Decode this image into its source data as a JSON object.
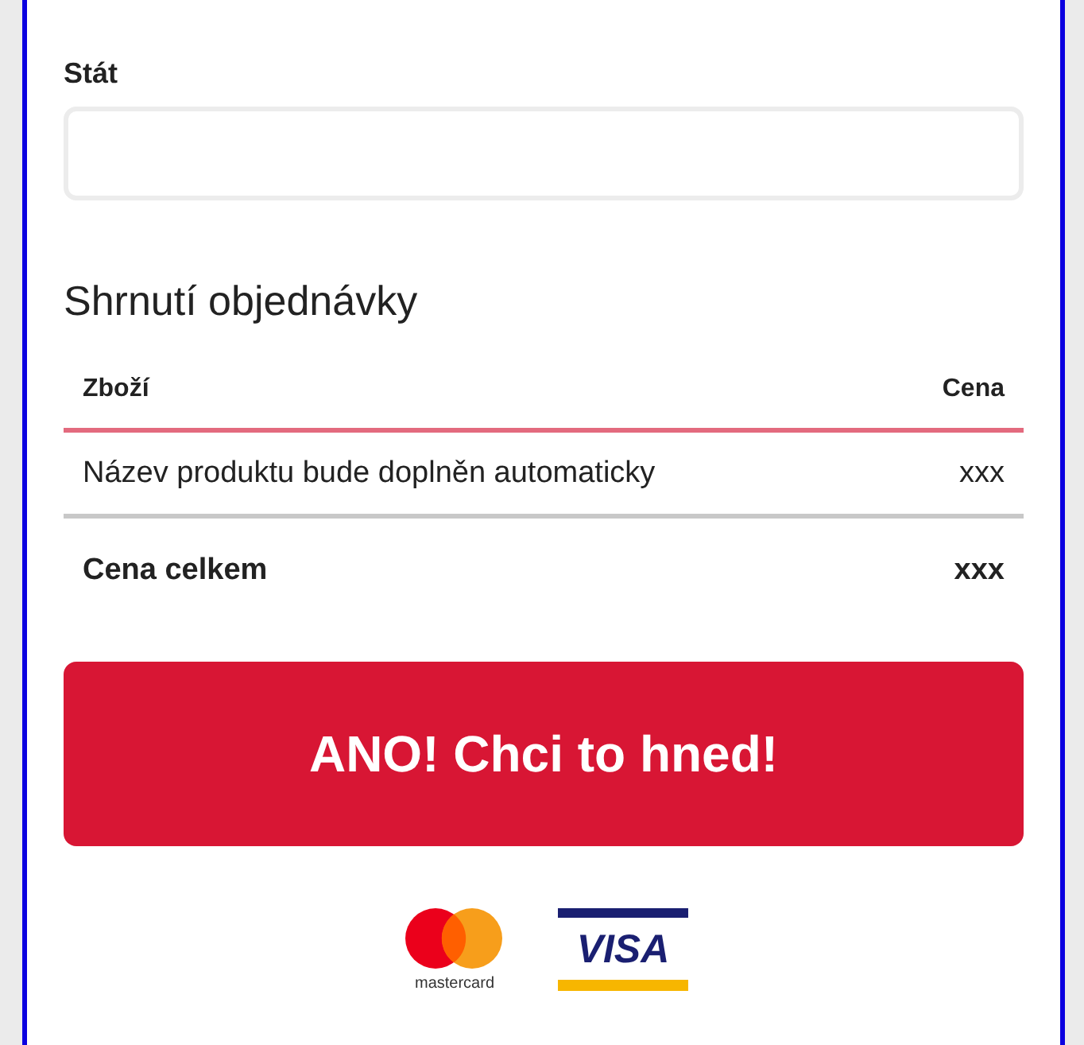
{
  "country_field": {
    "label": "Stát"
  },
  "order_summary": {
    "title": "Shrnutí objednávky",
    "columns": [
      "Zboží",
      "Cena"
    ],
    "rows": [
      {
        "product": "Název produktu bude doplněn automaticky",
        "price": "xxx"
      }
    ],
    "total": {
      "label": "Cena celkem",
      "price": "xxx"
    }
  },
  "submit_button": {
    "label": "ANO! Chci to hned!"
  },
  "payment_logos": [
    {
      "kind": "mastercard",
      "wordmark": "mastercard"
    },
    {
      "kind": "visa",
      "wordmark": "VISA"
    }
  ]
}
